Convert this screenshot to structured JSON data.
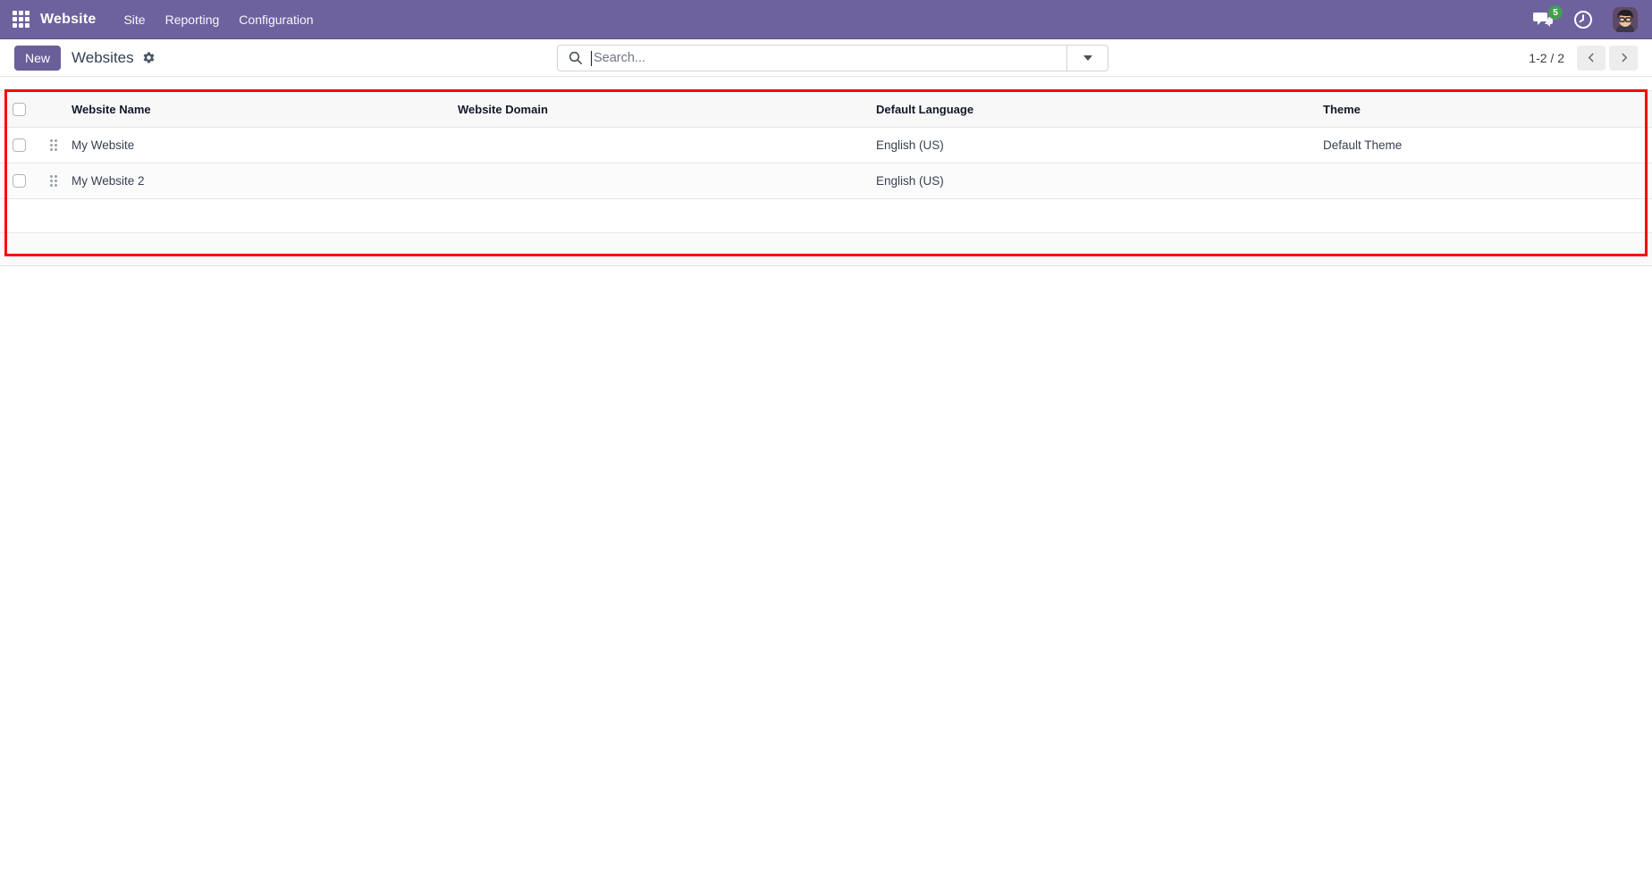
{
  "topbar": {
    "app_name": "Website",
    "menu_items": [
      "Site",
      "Reporting",
      "Configuration"
    ],
    "messages_badge": "5"
  },
  "control_panel": {
    "new_button_label": "New",
    "breadcrumb_title": "Websites",
    "search_placeholder": "Search...",
    "pager_text": "1-2 / 2"
  },
  "list": {
    "columns": [
      "Website Name",
      "Website Domain",
      "Default Language",
      "Theme"
    ],
    "rows": [
      {
        "website_name": "My Website",
        "website_domain": "",
        "default_language": "English (US)",
        "theme": "Default Theme"
      },
      {
        "website_name": "My Website 2",
        "website_domain": "",
        "default_language": "English (US)",
        "theme": ""
      }
    ]
  },
  "colors": {
    "topbar_bg": "#6e629e",
    "primary_button_bg": "#6b5f99",
    "badge_green": "#3fa14e",
    "annotation_red": "#ff0000"
  }
}
